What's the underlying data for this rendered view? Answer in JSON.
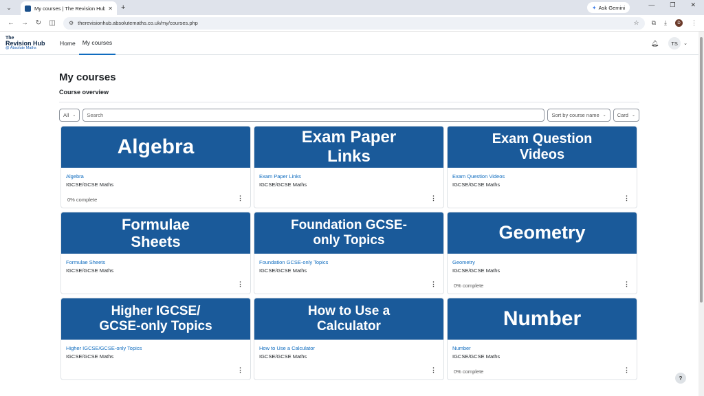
{
  "browser": {
    "tab_title": "My courses | The Revision Hub",
    "ask_label": "Ask Gemini",
    "url": "therevisionhub.absolutemaths.co.uk/my/courses.php",
    "profile_initial": "D"
  },
  "site": {
    "logo_line1": "The",
    "logo_line2": "Revision Hub",
    "logo_line3": "@ Absolute Maths",
    "nav": [
      {
        "label": "Home"
      },
      {
        "label": "My courses"
      }
    ],
    "user_initials": "TS"
  },
  "page": {
    "title": "My courses",
    "subtitle": "Course overview",
    "filter_label": "All",
    "search_placeholder": "Search",
    "sort_label": "Sort by course name",
    "view_label": "Card"
  },
  "courses": [
    {
      "banner": "Algebra",
      "name": "Algebra",
      "category": "IGCSE/GCSE Maths",
      "progress": "0% complete"
    },
    {
      "banner": "Exam Paper Links",
      "name": "Exam Paper Links",
      "category": "IGCSE/GCSE Maths",
      "progress": ""
    },
    {
      "banner": "Exam Question Videos",
      "name": "Exam Question Videos",
      "category": "IGCSE/GCSE Maths",
      "progress": ""
    },
    {
      "banner": "Formulae Sheets",
      "name": "Formulae Sheets",
      "category": "IGCSE/GCSE Maths",
      "progress": ""
    },
    {
      "banner": "Foundation GCSE-only Topics",
      "name": "Foundation GCSE-only Topics",
      "category": "IGCSE/GCSE Maths",
      "progress": ""
    },
    {
      "banner": "Geometry",
      "name": "Geometry",
      "category": "IGCSE/GCSE Maths",
      "progress": "0% complete"
    },
    {
      "banner": "Higher IGCSE/ GCSE-only Topics",
      "name": "Higher IGCSE/GCSE-only Topics",
      "category": "IGCSE/GCSE Maths",
      "progress": ""
    },
    {
      "banner": "How to Use a Calculator",
      "name": "How to Use a Calculator",
      "category": "IGCSE/GCSE Maths",
      "progress": ""
    },
    {
      "banner": "Number",
      "name": "Number",
      "category": "IGCSE/GCSE Maths",
      "progress": "0% complete"
    }
  ],
  "help_label": "?"
}
